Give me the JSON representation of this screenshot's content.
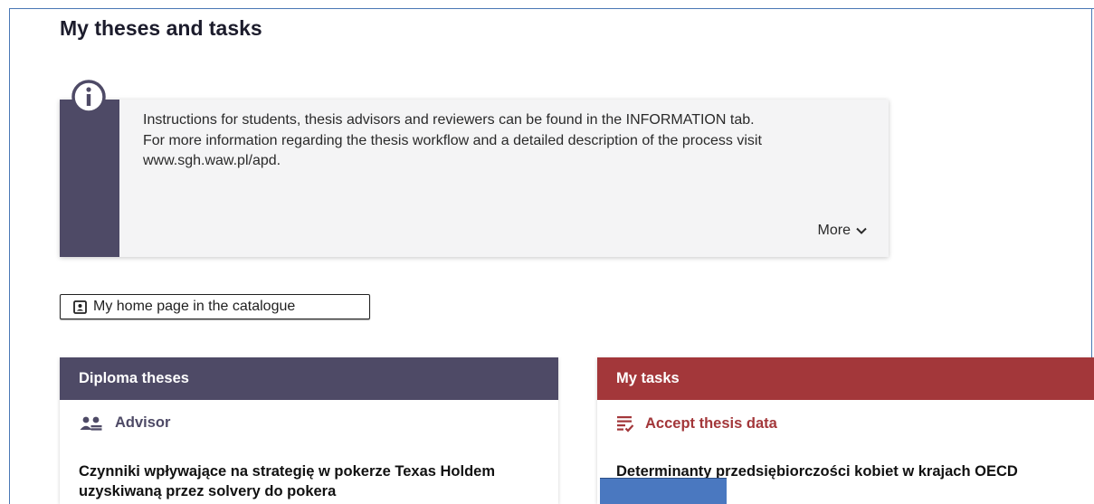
{
  "page": {
    "title": "My theses and tasks"
  },
  "info": {
    "icon": "info-circle-icon",
    "line1": "Instructions for students, thesis advisors and reviewers can be found in the INFORMATION tab.",
    "line2": "For more information regarding the thesis workflow and a detailed description of the process visit www.sgh.waw.pl/apd.",
    "more_label": "More"
  },
  "home_button": {
    "label": "My home page in the catalogue",
    "icon": "id-card-icon"
  },
  "diploma": {
    "header": "Diploma theses",
    "section_label": "Advisor",
    "section_icon": "people-icon",
    "thesis_title": "Czynniki wpływające na strategię w pokerze Texas Holdem uzyskiwaną przez solvery do pokera"
  },
  "tasks": {
    "header": "My tasks",
    "task_label": "Accept thesis data",
    "task_icon": "checklist-icon",
    "thesis_title": "Determinanty przedsiębiorczości kobiet w krajach OECD"
  },
  "colors": {
    "primary": "#4e4a66",
    "accent": "#a3373a",
    "frame": "#4a78b5"
  }
}
